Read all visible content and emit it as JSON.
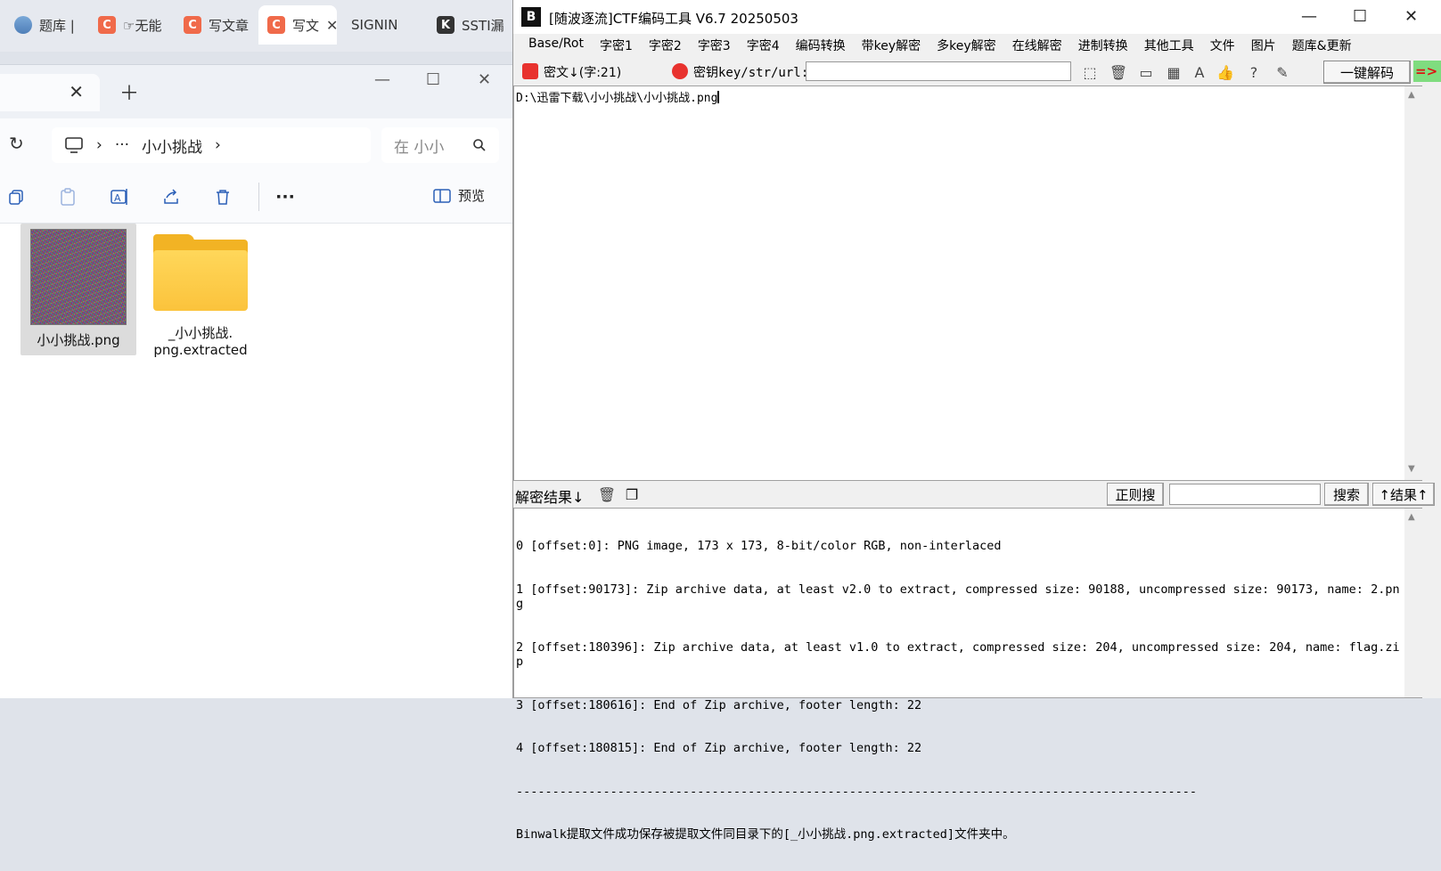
{
  "browser": {
    "tabs": [
      {
        "label": "题库 |",
        "icon": "database-icon"
      },
      {
        "label": "☞无能",
        "icon": "csdn-icon"
      },
      {
        "label": "写文章",
        "icon": "csdn-icon"
      },
      {
        "label": "写文",
        "icon": "csdn-icon",
        "active": true
      },
      {
        "label": "SIGNIN",
        "icon": ""
      },
      {
        "label": "SSTI漏",
        "icon": "k-icon"
      }
    ]
  },
  "explorer": {
    "breadcrumb": {
      "ellipsis": "···",
      "folder": "小小挑战"
    },
    "search_placeholder": "在 小小",
    "toolbar": {
      "more": "···",
      "preview": "预览"
    },
    "files": [
      {
        "name": "小小挑战.png",
        "type": "image"
      },
      {
        "name": "_小小挑战.\npng.extracted",
        "name_line1": "_小小挑战.",
        "name_line2": "png.extracted",
        "type": "folder"
      }
    ]
  },
  "ctf": {
    "title": "[随波逐流]CTF编码工具 V6.7  20250503",
    "logo_text": "B",
    "menu": [
      "Base/Rot",
      "字密1",
      "字密2",
      "字密3",
      "字密4",
      "编码转换",
      "带key解密",
      "多key解密",
      "在线解密",
      "进制转换",
      "其他工具",
      "文件",
      "图片",
      "题库&更新"
    ],
    "toolbar": {
      "cipher_label": "密文↓(字:21)",
      "key_label": "密钥key/str/url:",
      "key_value": "",
      "decode_button": "一键解码",
      "go_arrow": "=>"
    },
    "cipher_text": "D:\\迅雷下载\\小小挑战\\小小挑战.png",
    "result_bar": {
      "label": "解密结果↓",
      "regex_button": "正则搜",
      "search_button": "搜索",
      "result_up_button": "↑结果↑",
      "search_value": ""
    },
    "result_lines": [
      "0 [offset:0]: PNG image, 173 x 173, 8-bit/color RGB, non-interlaced",
      "1 [offset:90173]: Zip archive data, at least v2.0 to extract, compressed size: 90188, uncompressed size: 90173, name: 2.png",
      "2 [offset:180396]: Zip archive data, at least v1.0 to extract, compressed size: 204, uncompressed size: 204, name: flag.zip",
      "3 [offset:180616]: End of Zip archive, footer length: 22",
      "4 [offset:180815]: End of Zip archive, footer length: 22",
      "----------------------------------------------------------------------------------------------",
      "Binwalk提取文件成功保存被提取文件同目录下的[_小小挑战.png.extracted]文件夹中。"
    ]
  },
  "colors": {
    "accent_red": "#e8322e",
    "go_green": "#7fdc7f",
    "folder_yellow": "#f2b324",
    "explorer_icon_blue": "#2b5fb7"
  }
}
